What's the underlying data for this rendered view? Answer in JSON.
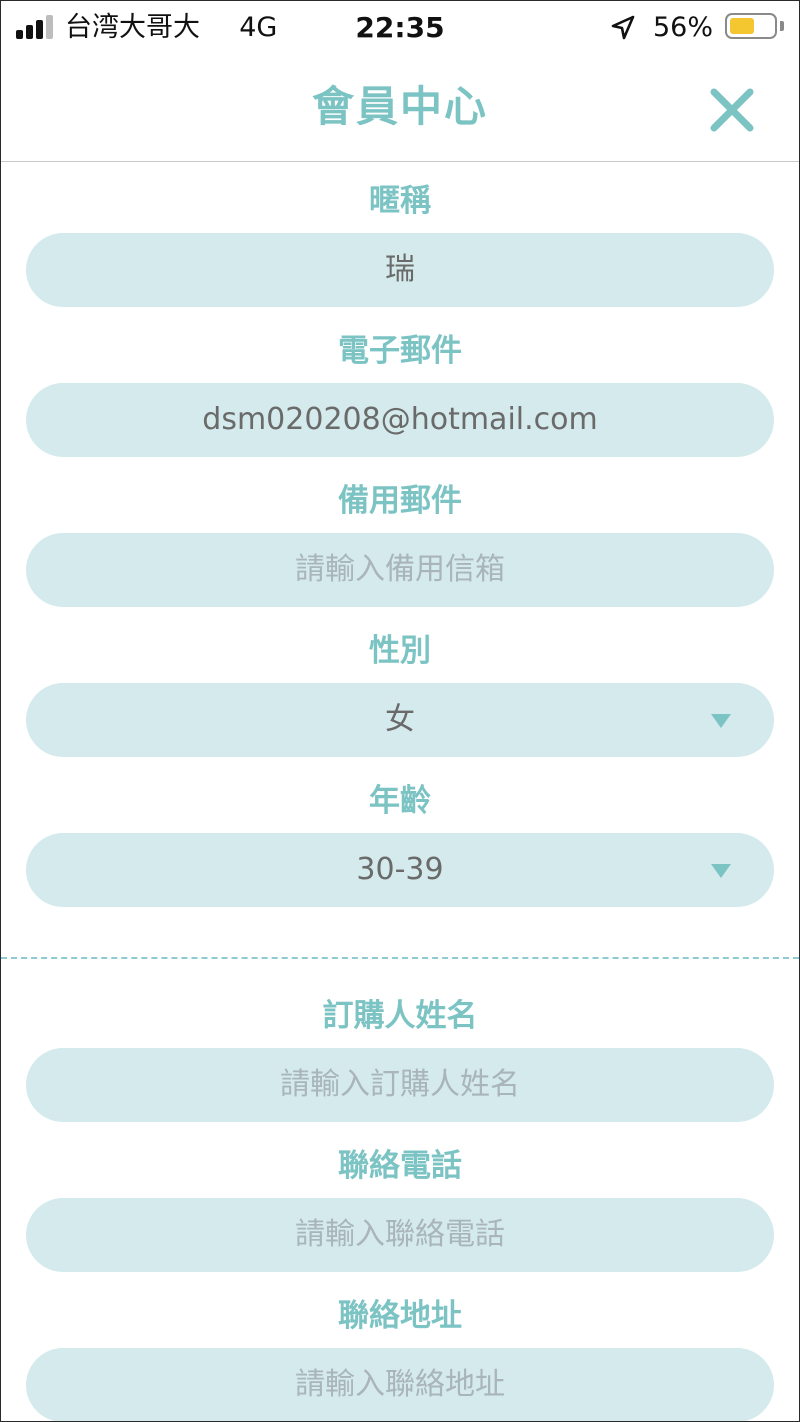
{
  "status_bar": {
    "carrier": "台湾大哥大",
    "network": "4G",
    "time": "22:35",
    "battery_percent": "56%",
    "battery_level": 0.56
  },
  "header": {
    "title": "會員中心"
  },
  "colors": {
    "accent": "#7cc3c4",
    "field_background": "#d4eaec",
    "value_text": "#6a6a6a",
    "placeholder_text": "#a9b5b8",
    "battery": "#f4c630"
  },
  "form": {
    "nickname": {
      "label": "暱稱",
      "value": "瑞",
      "placeholder": ""
    },
    "email": {
      "label": "電子郵件",
      "value": "dsm020208@hotmail.com",
      "placeholder": ""
    },
    "backup_email": {
      "label": "備用郵件",
      "value": "",
      "placeholder": "請輸入備用信箱"
    },
    "gender": {
      "label": "性別",
      "value": "女"
    },
    "age": {
      "label": "年齡",
      "value": "30-39"
    },
    "orderer_name": {
      "label": "訂購人姓名",
      "value": "",
      "placeholder": "請輸入訂購人姓名"
    },
    "phone": {
      "label": "聯絡電話",
      "value": "",
      "placeholder": "請輸入聯絡電話"
    },
    "address": {
      "label": "聯絡地址",
      "value": "",
      "placeholder": "請輸入聯絡地址"
    }
  },
  "icons": {
    "close": "close-icon",
    "location": "location-arrow-icon",
    "dropdown": "caret-down-icon"
  }
}
